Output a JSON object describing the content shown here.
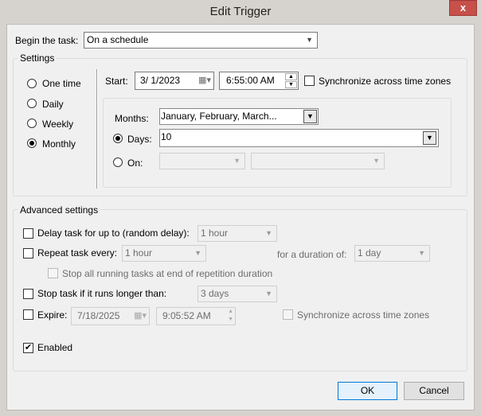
{
  "window": {
    "title": "Edit Trigger",
    "close": "x"
  },
  "begin": {
    "label": "Begin the task:",
    "value": "On a schedule"
  },
  "settings": {
    "label": "Settings",
    "types": [
      {
        "label": "One time",
        "selected": false
      },
      {
        "label": "Daily",
        "selected": false
      },
      {
        "label": "Weekly",
        "selected": false
      },
      {
        "label": "Monthly",
        "selected": true
      }
    ],
    "start_label": "Start:",
    "start_date": "3/  1/2023",
    "start_time": "6:55:00 AM",
    "sync_label": "Synchronize across time zones",
    "sync_checked": false,
    "months_label": "Months:",
    "months_value": "January, February, March...",
    "days_label": "Days:",
    "days_value": "10",
    "days_selected": true,
    "on_label": "On:",
    "on_selected": false
  },
  "advanced": {
    "label": "Advanced settings",
    "delay_label": "Delay task for up to (random delay):",
    "delay_value": "1 hour",
    "repeat_label": "Repeat task every:",
    "repeat_value": "1 hour",
    "duration_label": "for a duration of:",
    "duration_value": "1 day",
    "stop_all_label": "Stop all running tasks at end of repetition duration",
    "stop_label": "Stop task if it runs longer than:",
    "stop_value": "3 days",
    "expire_label": "Expire:",
    "expire_date": "7/18/2025",
    "expire_time": "9:05:52 AM",
    "expire_sync_label": "Synchronize across time zones",
    "enabled_label": "Enabled",
    "enabled_checked": true
  },
  "buttons": {
    "ok": "OK",
    "cancel": "Cancel"
  },
  "colors": {
    "close": "#c7504a",
    "background": "#f0f0f0"
  }
}
